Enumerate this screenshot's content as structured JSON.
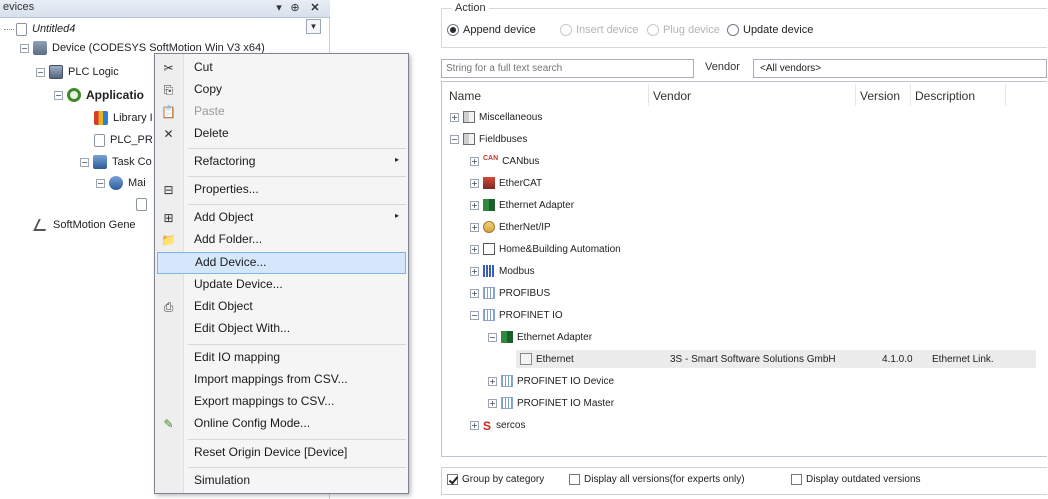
{
  "devices_panel": {
    "title": "evices",
    "pin_glyph": "▾ ↓ ✕",
    "tree": [
      {
        "label": "Untitled4"
      },
      {
        "label": "Device (CODESYS SoftMotion Win V3 x64)"
      },
      {
        "label": "PLC Logic"
      },
      {
        "label": "Applicatio"
      },
      {
        "label": "Library I"
      },
      {
        "label": "PLC_PR"
      },
      {
        "label": "Task Co"
      },
      {
        "label": "Mai"
      },
      {
        "label": "SoftMotion Gene"
      }
    ]
  },
  "context_menu": {
    "items": [
      {
        "label": "Cut",
        "icon": "✂"
      },
      {
        "label": "Copy",
        "icon": "⎘"
      },
      {
        "label": "Paste",
        "icon": "📋"
      },
      {
        "label": "Delete",
        "icon": "✕"
      },
      {
        "label": "Refactoring",
        "icon": "",
        "submenu": "▸"
      },
      {
        "label": "Properties...",
        "icon": "⊟"
      },
      {
        "label": "Add Object",
        "icon": "⊞",
        "submenu": "▸"
      },
      {
        "label": "Add Folder...",
        "icon": "📁"
      },
      {
        "label": "Add Device...",
        "icon": ""
      },
      {
        "label": "Update Device...",
        "icon": ""
      },
      {
        "label": "Edit Object",
        "icon": "⎙"
      },
      {
        "label": "Edit Object With...",
        "icon": ""
      },
      {
        "label": "Edit IO mapping",
        "icon": ""
      },
      {
        "label": "Import mappings from CSV...",
        "icon": ""
      },
      {
        "label": "Export mappings to CSV...",
        "icon": ""
      },
      {
        "label": "Online Config Mode...",
        "icon": "✎"
      },
      {
        "label": "Reset Origin Device [Device]",
        "icon": ""
      },
      {
        "label": "Simulation",
        "icon": ""
      }
    ]
  },
  "add_device_dialog": {
    "action_title": "Action",
    "radios": [
      {
        "label": "Append device",
        "checked": true,
        "enabled": true
      },
      {
        "label": "Insert device",
        "checked": false,
        "enabled": false
      },
      {
        "label": "Plug device",
        "checked": false,
        "enabled": false
      },
      {
        "label": "Update device",
        "checked": false,
        "enabled": true
      }
    ],
    "search_placeholder": "String for a full text search",
    "vendor_label": "Vendor",
    "vendor_value": "<All vendors>",
    "columns": {
      "name": "Name",
      "vendor": "Vendor",
      "version": "Version",
      "description": "Description"
    },
    "tree": [
      {
        "label": "Miscellaneous"
      },
      {
        "label": "Fieldbuses"
      },
      {
        "label": "CANbus",
        "icon_text": "CAN"
      },
      {
        "label": "EtherCAT"
      },
      {
        "label": "Ethernet Adapter"
      },
      {
        "label": "EtherNet/IP"
      },
      {
        "label": "Home&Building Automation"
      },
      {
        "label": "Modbus"
      },
      {
        "label": "PROFIBUS"
      },
      {
        "label": "PROFINET IO"
      },
      {
        "label": "Ethernet Adapter"
      },
      {
        "label": "Ethernet",
        "vendor": "3S - Smart Software Solutions GmbH",
        "version": "4.1.0.0",
        "description": "Ethernet Link."
      },
      {
        "label": "PROFINET IO Device"
      },
      {
        "label": "PROFINET IO Master"
      },
      {
        "label": "sercos",
        "icon_text": "S"
      }
    ],
    "checkboxes": [
      {
        "label": "Group by category",
        "checked": true
      },
      {
        "label": "Display all versions(for experts only)",
        "checked": false
      },
      {
        "label": "Display outdated versions",
        "checked": false
      }
    ]
  }
}
